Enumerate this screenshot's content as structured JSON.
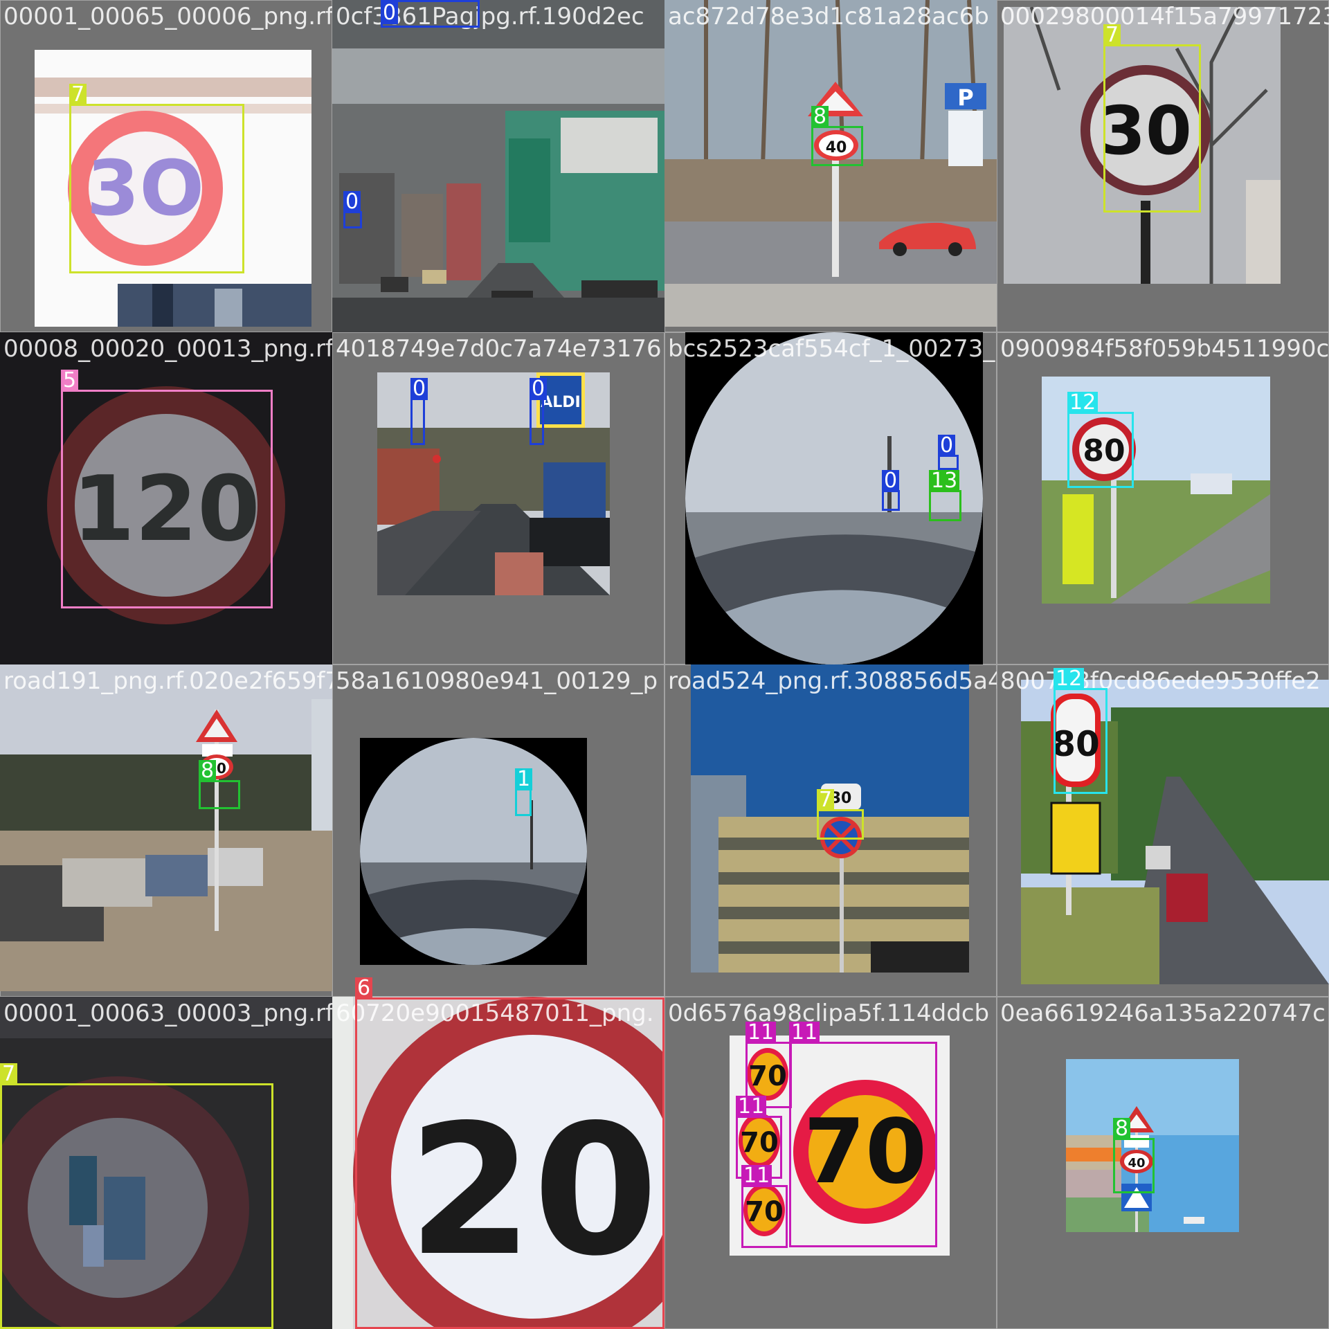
{
  "colors": {
    "class_0": "#1e3fd8",
    "class_1": "#14cfd8",
    "class_5": "#f07ec6",
    "class_6": "#e5454f",
    "class_7": "#cde22a",
    "class_8": "#22c232",
    "class_11": "#c71ab7",
    "class_12": "#27e4ec",
    "class_13": "#2bbf1c"
  },
  "tiles": [
    {
      "filename": "00001_00065_00006_png.rf.",
      "labels": [
        "7"
      ]
    },
    {
      "filename": "0cf3861Pagjpg.rf.190d2ec",
      "labels": [
        "0",
        "0"
      ]
    },
    {
      "filename": "ac872d78e3d1c81a28ac6b",
      "labels": [
        "8"
      ]
    },
    {
      "filename": "00029800014f15a79971723",
      "labels": [
        "7"
      ]
    },
    {
      "filename": "00008_00020_00013_png.rf.",
      "labels": [
        "5"
      ]
    },
    {
      "filename": "4018749e7d0c7a74e73176",
      "labels": [
        "0",
        "0"
      ]
    },
    {
      "filename": "bcs2523caf554cf_1_00273_p",
      "labels": [
        "0",
        "0",
        "13"
      ]
    },
    {
      "filename": "0900984f58f059b4511990c",
      "labels": [
        "12"
      ]
    },
    {
      "filename": "road191_png.rf.020e2f659f7",
      "labels": [
        "8"
      ]
    },
    {
      "filename": "58a1610980e941_00129_p",
      "labels": [
        "1"
      ]
    },
    {
      "filename": "road524_png.rf.308856d5a4c",
      "labels": [
        "7"
      ]
    },
    {
      "filename": "8007b8f0cd86ede9530ffe2",
      "labels": [
        "12"
      ]
    },
    {
      "filename": "00001_00063_00003_png.rf.",
      "labels": [
        "7"
      ]
    },
    {
      "filename": "60720e90015487011_png.",
      "labels": [
        "6"
      ]
    },
    {
      "filename": "0d6576a98clipa5f.114ddcb",
      "labels": [
        "11",
        "11",
        "11",
        "11"
      ]
    },
    {
      "filename": "0ea6619246a135a220747c",
      "labels": [
        "8"
      ]
    }
  ]
}
